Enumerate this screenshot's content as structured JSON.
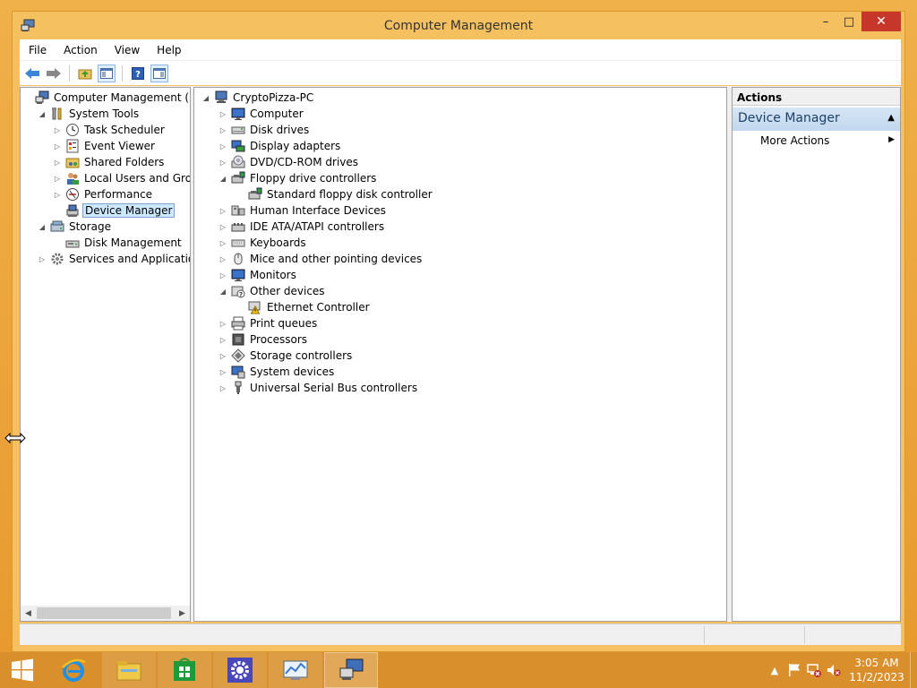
{
  "window": {
    "title": "Computer Management",
    "controls": {
      "minimize": "–",
      "maximize": "□",
      "close": "✕"
    }
  },
  "menu": [
    "File",
    "Action",
    "View",
    "Help"
  ],
  "toolbar": [
    "back-icon",
    "forward-icon",
    "up-folder-icon",
    "show-hide-tree-icon",
    "help-icon",
    "properties-icon"
  ],
  "left_tree": [
    {
      "label": "Computer Management (Local",
      "level": 0,
      "expander": "",
      "icon": "computer-management-icon"
    },
    {
      "label": "System Tools",
      "level": 1,
      "expander": "◢",
      "icon": "tools-icon"
    },
    {
      "label": "Task Scheduler",
      "level": 2,
      "expander": "▷",
      "icon": "clock-icon"
    },
    {
      "label": "Event Viewer",
      "level": 2,
      "expander": "▷",
      "icon": "event-viewer-icon"
    },
    {
      "label": "Shared Folders",
      "level": 2,
      "expander": "▷",
      "icon": "shared-folder-icon"
    },
    {
      "label": "Local Users and Groups",
      "level": 2,
      "expander": "▷",
      "icon": "users-icon"
    },
    {
      "label": "Performance",
      "level": 2,
      "expander": "▷",
      "icon": "performance-icon"
    },
    {
      "label": "Device Manager",
      "level": 2,
      "expander": "",
      "icon": "device-manager-icon",
      "selected": true
    },
    {
      "label": "Storage",
      "level": 1,
      "expander": "◢",
      "icon": "storage-icon"
    },
    {
      "label": "Disk Management",
      "level": 2,
      "expander": "",
      "icon": "disk-management-icon"
    },
    {
      "label": "Services and Applications",
      "level": 1,
      "expander": "▷",
      "icon": "services-icon"
    }
  ],
  "device_tree": [
    {
      "label": "CryptoPizza-PC",
      "level": 0,
      "expander": "◢",
      "icon": "pc-icon"
    },
    {
      "label": "Computer",
      "level": 1,
      "expander": "▷",
      "icon": "monitor-icon"
    },
    {
      "label": "Disk drives",
      "level": 1,
      "expander": "▷",
      "icon": "disk-drive-icon"
    },
    {
      "label": "Display adapters",
      "level": 1,
      "expander": "▷",
      "icon": "display-adapter-icon"
    },
    {
      "label": "DVD/CD-ROM drives",
      "level": 1,
      "expander": "▷",
      "icon": "dvd-icon"
    },
    {
      "label": "Floppy drive controllers",
      "level": 1,
      "expander": "◢",
      "icon": "floppy-controller-icon"
    },
    {
      "label": "Standard floppy disk controller",
      "level": 2,
      "expander": "",
      "icon": "floppy-controller-icon"
    },
    {
      "label": "Human Interface Devices",
      "level": 1,
      "expander": "▷",
      "icon": "hid-icon"
    },
    {
      "label": "IDE ATA/ATAPI controllers",
      "level": 1,
      "expander": "▷",
      "icon": "ide-controller-icon"
    },
    {
      "label": "Keyboards",
      "level": 1,
      "expander": "▷",
      "icon": "keyboard-icon"
    },
    {
      "label": "Mice and other pointing devices",
      "level": 1,
      "expander": "▷",
      "icon": "mouse-icon"
    },
    {
      "label": "Monitors",
      "level": 1,
      "expander": "▷",
      "icon": "monitor-icon"
    },
    {
      "label": "Other devices",
      "level": 1,
      "expander": "◢",
      "icon": "unknown-device-icon"
    },
    {
      "label": "Ethernet Controller",
      "level": 2,
      "expander": "",
      "icon": "warning-device-icon"
    },
    {
      "label": "Print queues",
      "level": 1,
      "expander": "▷",
      "icon": "printer-icon"
    },
    {
      "label": "Processors",
      "level": 1,
      "expander": "▷",
      "icon": "processor-icon"
    },
    {
      "label": "Storage controllers",
      "level": 1,
      "expander": "▷",
      "icon": "storage-controller-icon"
    },
    {
      "label": "System devices",
      "level": 1,
      "expander": "▷",
      "icon": "system-device-icon"
    },
    {
      "label": "Universal Serial Bus controllers",
      "level": 1,
      "expander": "▷",
      "icon": "usb-icon"
    }
  ],
  "actions": {
    "header": "Actions",
    "section": "Device Manager",
    "collapse_glyph": "▲",
    "items": [
      {
        "label": "More Actions",
        "arrow": "▶"
      }
    ]
  },
  "taskbar": {
    "items": [
      "start-icon",
      "internet-explorer-icon",
      "file-explorer-icon",
      "store-icon",
      "settings-icon",
      "performance-monitor-icon",
      "computer-management-icon"
    ],
    "tray": [
      "show-hidden-icons-icon",
      "action-center-flag-icon",
      "network-disconnected-icon",
      "volume-muted-icon"
    ],
    "time": "3:05 AM",
    "date": "11/2/2023"
  },
  "colors": {
    "accent": "#e8a33a",
    "close": "#c7362b",
    "selection": "#cce8ff",
    "actions_section": "#c2d8ee"
  }
}
